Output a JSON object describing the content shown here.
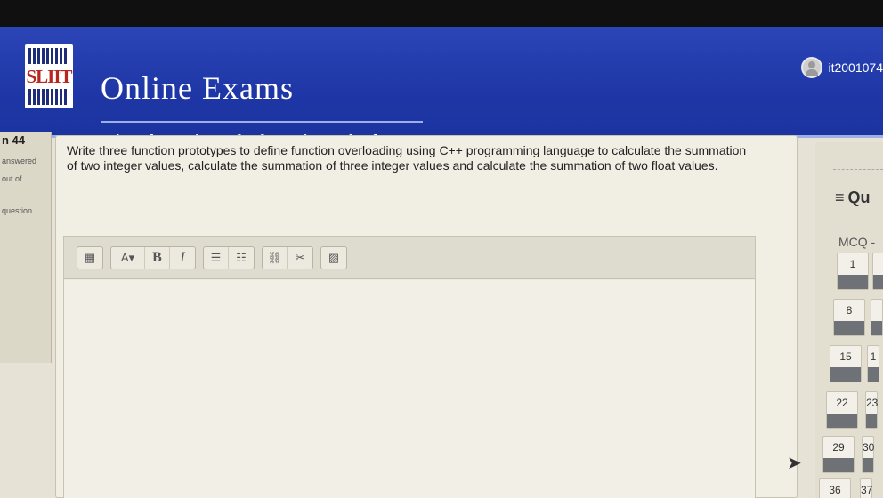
{
  "header": {
    "logo_text": "SLIIT",
    "site_title": "Online Exams",
    "site_subtitle": "Sri Lanka Institute of Information Technology",
    "username": "it2001074"
  },
  "question_info": {
    "number": "n 44",
    "status": "answered",
    "marks": "out of",
    "flag": "question"
  },
  "question": {
    "text": "Write three function prototypes to define function overloading using C++ programming language to calculate the summation of two integer values, calculate the summation of three integer values and calculate the summation of two float values."
  },
  "editor": {
    "toolbar": {
      "font_size_label": "A",
      "bold_label": "B",
      "italic_label": "I"
    }
  },
  "navigation": {
    "title": "Qu",
    "section": "MCQ -",
    "buttons": [
      "1",
      "8",
      "15",
      "1",
      "22",
      "23",
      "29",
      "30",
      "36",
      "37"
    ]
  }
}
